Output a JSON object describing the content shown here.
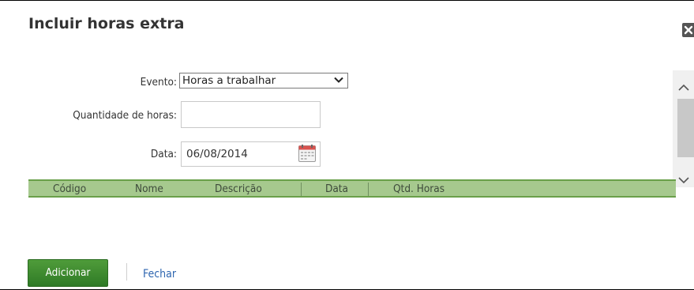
{
  "dialog": {
    "title": "Incluir horas extra"
  },
  "form": {
    "evento": {
      "label": "Evento:",
      "value": "Horas a trabalhar"
    },
    "quantidade": {
      "label": "Quantidade de horas:",
      "value": ""
    },
    "data": {
      "label": "Data:",
      "value": "06/08/2014"
    }
  },
  "grid": {
    "columns": [
      "Código",
      "Nome",
      "Descrição",
      "Data",
      "Qtd. Horas"
    ]
  },
  "actions": {
    "add_label": "Adicionar",
    "close_label": "Fechar"
  },
  "icons": {
    "close": "close-icon",
    "calendar": "calendar-icon",
    "dropdown": "chevron-down-icon"
  },
  "colors": {
    "header_bg": "#a6c98e",
    "header_border": "#6aa04a",
    "primary_button": "#3f8c30",
    "link": "#2f66b0"
  }
}
